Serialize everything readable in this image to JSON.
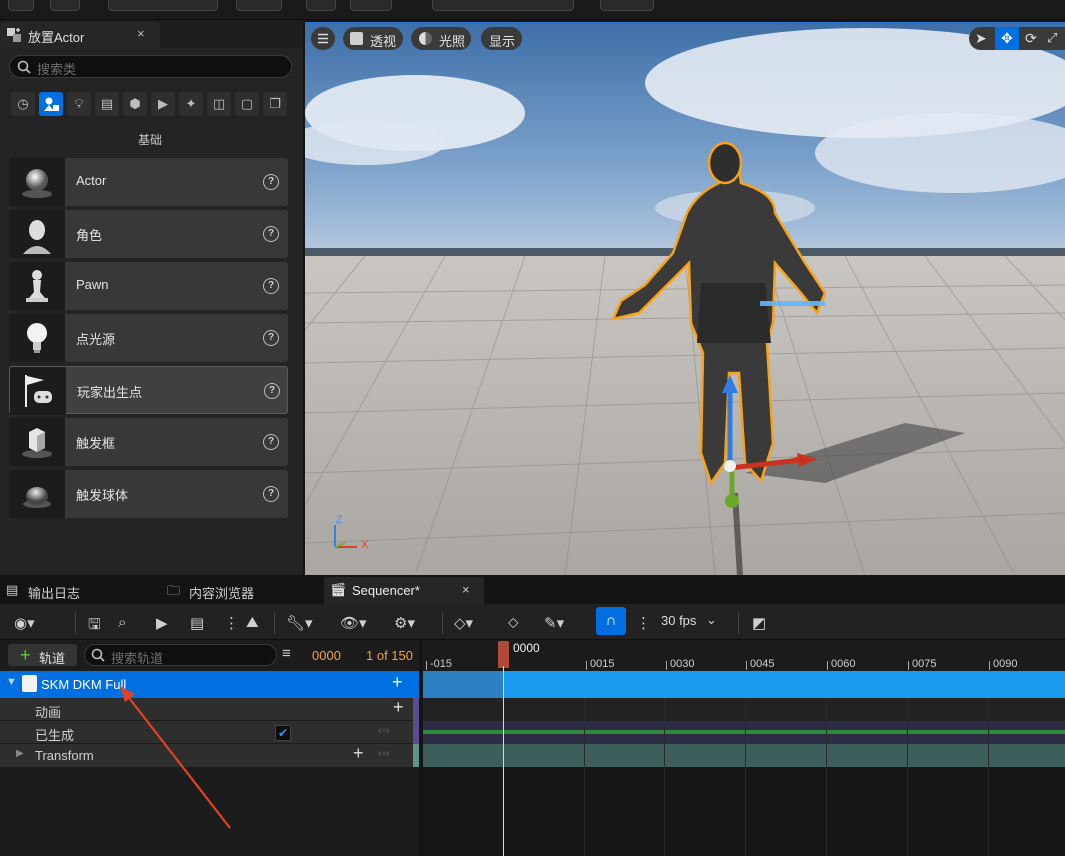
{
  "place_actor": {
    "tab_title": "放置Actor",
    "close_glyph": "×",
    "search_placeholder": "搜索类",
    "section_label": "基础",
    "category_icons": [
      "recent-icon",
      "basic-icon",
      "lights-icon",
      "cinematic-icon",
      "visual-effects-icon",
      "geometry-icon",
      "volumes-icon",
      "all-classes-icon",
      "shapes-icon",
      "other-icon"
    ],
    "items": [
      {
        "label": "Actor",
        "icon": "sphere-icon"
      },
      {
        "label": "角色",
        "icon": "character-icon"
      },
      {
        "label": "Pawn",
        "icon": "pawn-icon"
      },
      {
        "label": "点光源",
        "icon": "point-light-icon"
      },
      {
        "label": "玩家出生点",
        "icon": "player-start-icon"
      },
      {
        "label": "触发框",
        "icon": "trigger-box-icon"
      },
      {
        "label": "触发球体",
        "icon": "trigger-sphere-icon"
      }
    ]
  },
  "viewport": {
    "perspective_label": "透视",
    "lighting_label": "光照",
    "show_label": "显示",
    "axis_z": "Z",
    "axis_x": "X",
    "accent_outline": "#f7a21b"
  },
  "bottom_tabs": {
    "output_log": "输出日志",
    "content_browser": "内容浏览器",
    "sequencer": "Sequencer*",
    "close_glyph": "×"
  },
  "sequencer": {
    "add_track_label": "轨道",
    "search_placeholder": "搜索轨道",
    "current_frame": "0000",
    "frame_count": "1 of 150",
    "fps": "30 fps",
    "playhead_label": "0000",
    "ruler_labels": [
      "-015",
      "0015",
      "0030",
      "0045",
      "0060",
      "0075",
      "0090"
    ],
    "tracks": {
      "actor_name": "SKM DKM Full",
      "animation": "动画",
      "spawned": "已生成",
      "transform": "Transform"
    },
    "colors": {
      "selection": "#0070e0",
      "timeline_bar": "#1a9bf0",
      "spawned_line": "#2e8b3e",
      "transform_bar": "#3b5e5a",
      "playhead": "#b04a36",
      "annotation_arrow": "#e0432a"
    }
  }
}
